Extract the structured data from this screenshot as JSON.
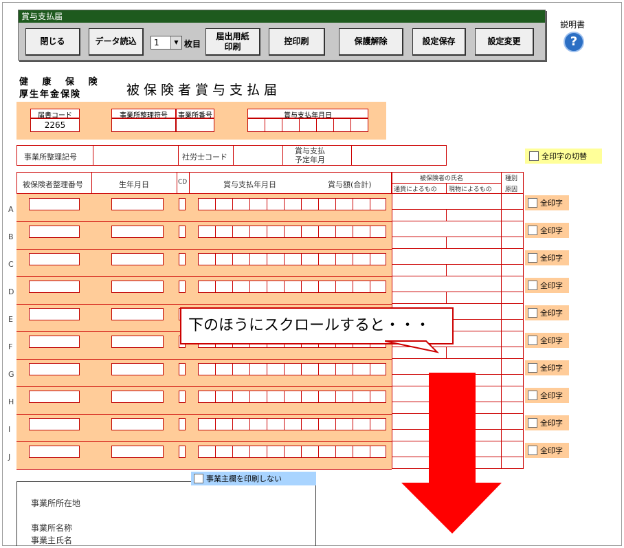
{
  "window_title": "賞与支払届",
  "toolbar": {
    "close": "閉じる",
    "load": "データ読込",
    "copies_value": "1",
    "copies_unit": "枚目",
    "print_form": "届出用紙\n印刷",
    "print_copy": "控印刷",
    "unprotect": "保護解除",
    "save_settings": "設定保存",
    "change_settings": "設定変更"
  },
  "help_label": "説明書",
  "form": {
    "header_line1": "健 康 保 険",
    "header_line2": "厚生年金保険",
    "title": "被保険者賞与支払届",
    "notification_code_label": "届書コード",
    "notification_code": "2265",
    "office_code_label": "事業所整理符号",
    "office_number_label": "事業所番号",
    "pay_date_label": "賞与支払年月日",
    "office_mark_label": "事業所整理記号",
    "labor_code_label": "社労士コード",
    "planned_label": "賞与支払\n予定年月",
    "all_print_toggle": "全印字の切替",
    "col_insured_no": "被保険者整理番号",
    "col_birth": "生年月日",
    "col_cd": "CD",
    "col_paydate": "賞与支払年月日",
    "col_amount": "賞与額(合計)",
    "col_name": "被保険者の氏名",
    "col_currency": "通貨によるもの",
    "col_goods": "現物によるもの",
    "col_kind": "種別",
    "col_cause": "原因",
    "row_print": "全印字",
    "rows": [
      "A",
      "B",
      "C",
      "D",
      "E",
      "F",
      "G",
      "H",
      "I",
      "J"
    ],
    "employer_no_print": "事業主欄を印刷しない",
    "addr_label": "事業所所在地",
    "office_name_label": "事業所名称",
    "owner_name_label": "事業主氏名"
  },
  "callout_text": "下のほうにスクロールすると・・・",
  "colors": {
    "accent_red": "#cc0000",
    "peach": "#ffcc99",
    "title_bar": "#1e5a1e",
    "arrow": "#ff0000"
  }
}
